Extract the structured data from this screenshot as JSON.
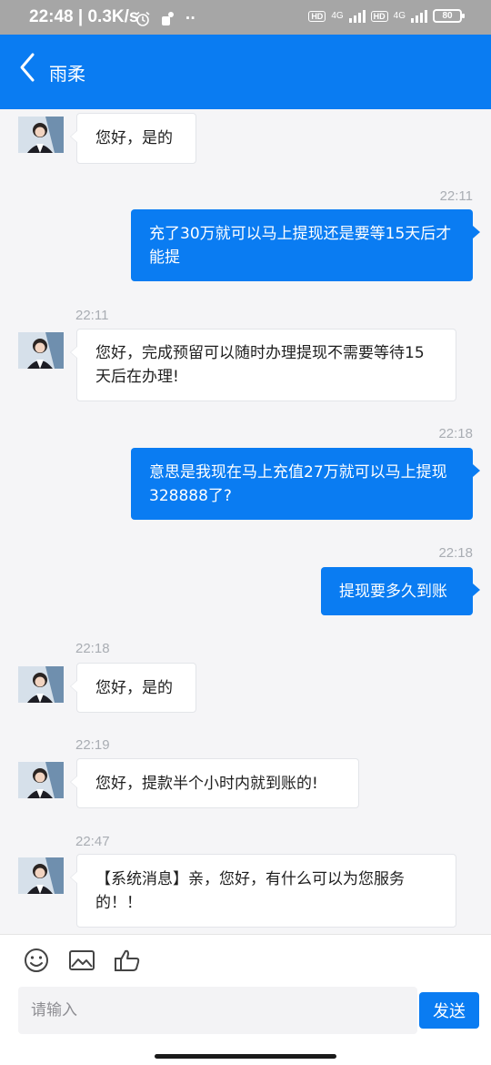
{
  "status_bar": {
    "time_speed": "22:48 | 0.3K/s",
    "hd1": "HD",
    "net1": "4G",
    "hd2": "HD",
    "net2": "4G",
    "battery": "80"
  },
  "header": {
    "title": "雨柔"
  },
  "messages": [
    {
      "side": "in",
      "time": "",
      "text": "您好，是的"
    },
    {
      "side": "out",
      "time": "22:11",
      "text": "充了30万就可以马上提现还是要等15天后才能提"
    },
    {
      "side": "in",
      "time": "22:11",
      "text": "您好，完成预留可以随时办理提现不需要等待15天后在办理!"
    },
    {
      "side": "out",
      "time": "22:18",
      "text": "意思是我现在马上充值27万就可以马上提现328888了?"
    },
    {
      "side": "out",
      "time": "22:18",
      "text": "提现要多久到账"
    },
    {
      "side": "in",
      "time": "22:18",
      "text": "您好，是的"
    },
    {
      "side": "in",
      "time": "22:19",
      "text": "您好，提款半个小时内就到账的!"
    },
    {
      "side": "in",
      "time": "22:47",
      "text": "【系统消息】亲，您好，有什么可以为您服务的！！"
    }
  ],
  "input": {
    "placeholder": "请输入"
  },
  "send_label": "发送",
  "icons": [
    "back-icon",
    "emoji-icon",
    "image-icon",
    "thumbs-up-icon"
  ],
  "colors": {
    "primary": "#0a7cf2",
    "background": "#f5f5f7",
    "timestamp": "#a9adb3"
  }
}
